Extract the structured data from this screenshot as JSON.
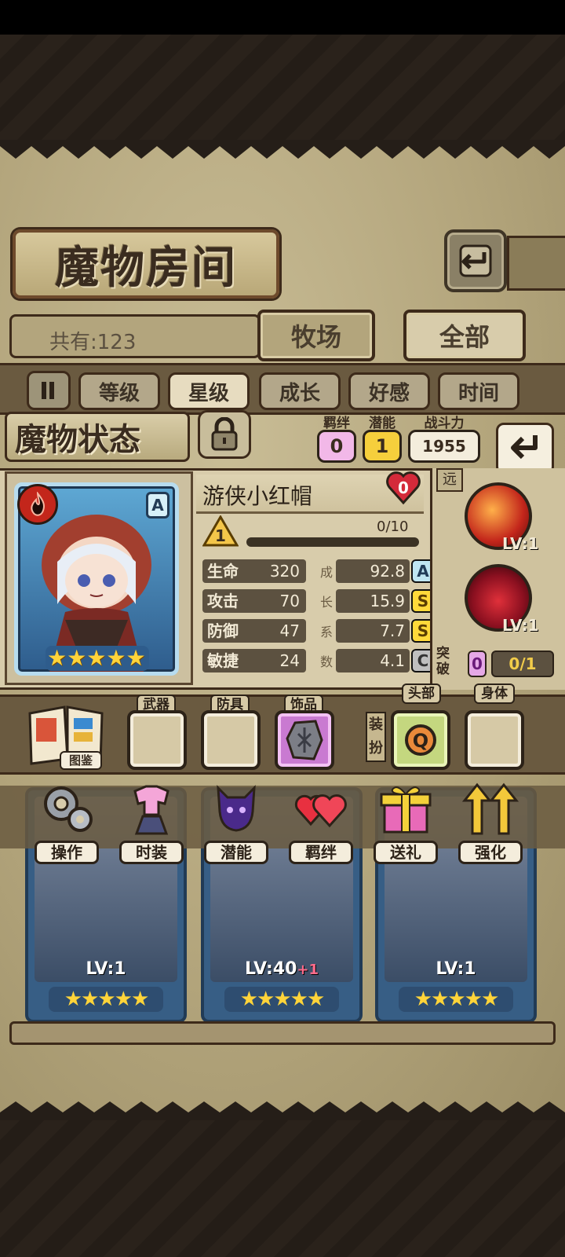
{
  "header": {
    "title": "魔物房间"
  },
  "collection": {
    "count_label": "共有:123"
  },
  "tabs": [
    {
      "label": "牧场"
    },
    {
      "label": "全部"
    }
  ],
  "sort_buttons": [
    {
      "label": "等级"
    },
    {
      "label": "星级"
    },
    {
      "label": "成长"
    },
    {
      "label": "好感"
    },
    {
      "label": "时间"
    }
  ],
  "status": {
    "title": "魔物状态",
    "bond_label": "羁绊",
    "bond_value": "0",
    "potential_label": "潜能",
    "potential_value": "1",
    "power_label": "战斗力",
    "power_value": "1955"
  },
  "monster": {
    "name": "游侠小红帽",
    "element": "fire-icon",
    "rank": "A",
    "stars": 5,
    "affection": "0",
    "level": "1",
    "exp_text": "0/10",
    "exp_fraction": 0,
    "growth_label_chars": [
      "成",
      "长",
      "系",
      "数"
    ],
    "stats": [
      {
        "name": "生命",
        "value": "320",
        "growth": "92.8",
        "grade": "A"
      },
      {
        "name": "攻击",
        "value": "70",
        "growth": "15.9",
        "grade": "S"
      },
      {
        "name": "防御",
        "value": "47",
        "growth": "7.7",
        "grade": "S"
      },
      {
        "name": "敏捷",
        "value": "24",
        "growth": "4.1",
        "grade": "C"
      }
    ],
    "range": "远",
    "skills": [
      {
        "name": "skill-1",
        "level": "LV:1",
        "color": "#c3261b"
      },
      {
        "name": "skill-2",
        "level": "LV:1",
        "color": "#8c1020"
      }
    ],
    "breakthrough_label": "突破",
    "breakthrough_value": "0",
    "breakthrough_progress": "0/1"
  },
  "equipment": {
    "codex_label": "图鉴",
    "dress_label": "装扮",
    "slots": [
      {
        "label": "武器"
      },
      {
        "label": "防具"
      },
      {
        "label": "饰品"
      },
      {
        "label": "头部"
      },
      {
        "label": "身体"
      }
    ]
  },
  "actions": [
    {
      "label": "操作"
    },
    {
      "label": "时装"
    },
    {
      "label": "潜能"
    },
    {
      "label": "羁绊"
    },
    {
      "label": "送礼"
    },
    {
      "label": "强化"
    }
  ],
  "grid": [
    {
      "level": "LV:1",
      "plus": "",
      "stars": "★★★★★"
    },
    {
      "level": "LV:40",
      "plus": "+1",
      "stars": "★★★★★"
    },
    {
      "level": "LV:1",
      "plus": "",
      "stars": "★★★★★"
    }
  ],
  "colors": {
    "accent_gold": "#ffd43a",
    "parchment": "#c9bd96",
    "frame": "#3d2a1a"
  }
}
